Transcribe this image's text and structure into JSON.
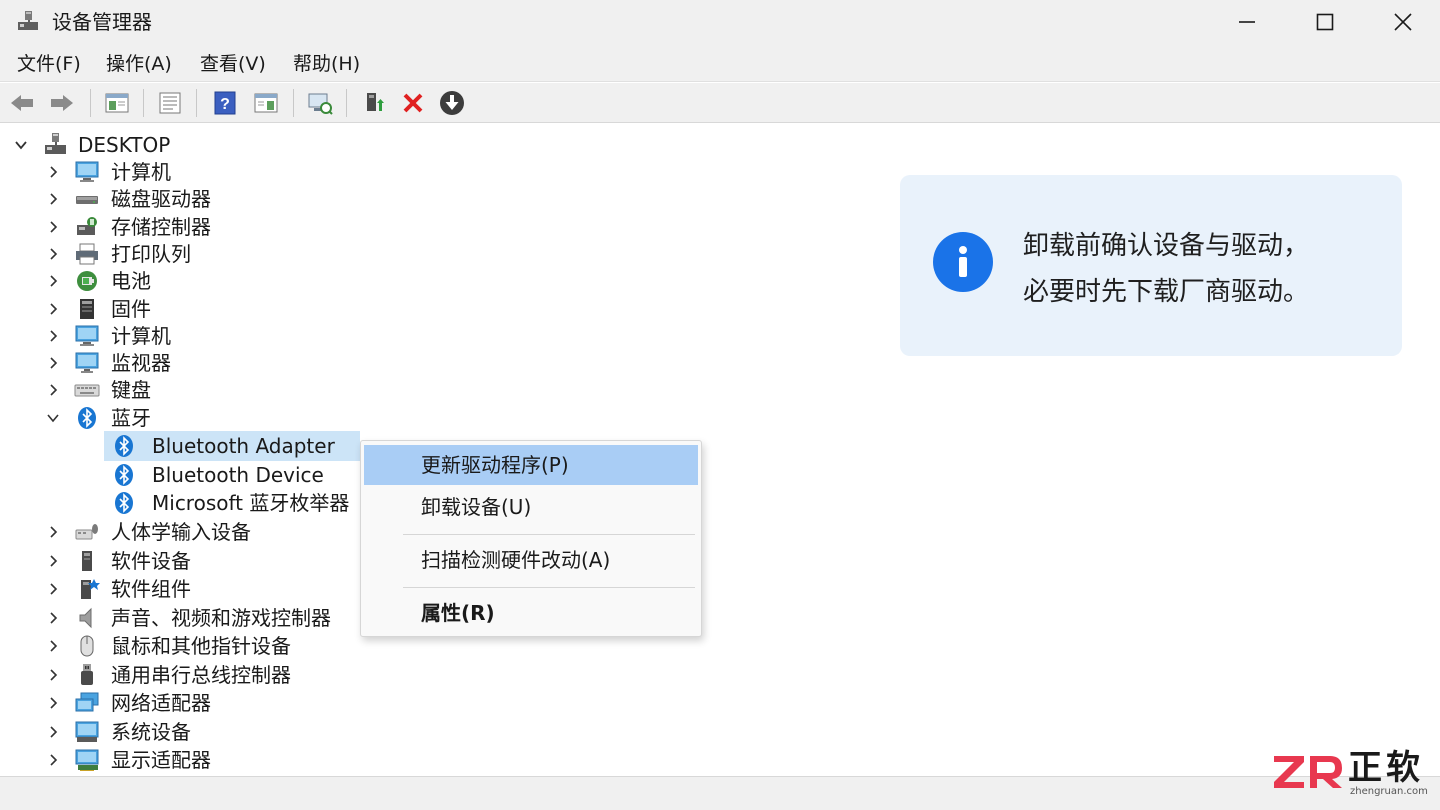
{
  "window": {
    "title": "设备管理器",
    "title_icon": "device-manager-icon",
    "controls": [
      "minimize-icon",
      "maximize-icon",
      "close-icon"
    ]
  },
  "menubar": {
    "items": [
      {
        "label": "文件(F)"
      },
      {
        "label": "操作(A)"
      },
      {
        "label": "查看(V)"
      },
      {
        "label": "帮助(H)"
      }
    ]
  },
  "toolbar": {
    "buttons": [
      "back-icon",
      "forward-icon",
      "show-hide-tree-icon",
      "properties-icon",
      "help-icon",
      "action-pane-icon",
      "scan-hardware-icon",
      "update-driver-icon",
      "uninstall-icon",
      "download-icon"
    ]
  },
  "tree": {
    "root": "DESKTOP",
    "categories": [
      {
        "label": "计算机",
        "icon": "computer-icon"
      },
      {
        "label": "磁盘驱动器",
        "icon": "disk-drive-icon"
      },
      {
        "label": "存储控制器",
        "icon": "storage-controller-icon"
      },
      {
        "label": "打印队列",
        "icon": "printer-icon"
      },
      {
        "label": "电池",
        "icon": "battery-icon"
      },
      {
        "label": "固件",
        "icon": "firmware-icon"
      },
      {
        "label": "计算机",
        "icon": "computer-icon"
      },
      {
        "label": "监视器",
        "icon": "monitor-icon"
      },
      {
        "label": "键盘",
        "icon": "keyboard-icon"
      },
      {
        "label": "蓝牙",
        "icon": "bluetooth-icon",
        "expanded": true
      }
    ],
    "bluetooth_children": [
      {
        "label": "Bluetooth Adapter",
        "selected": true
      },
      {
        "label": "Bluetooth Device"
      },
      {
        "label": "Microsoft 蓝牙枚举器"
      }
    ],
    "categories_after": [
      {
        "label": "人体学输入设备",
        "icon": "hid-icon"
      },
      {
        "label": "软件设备",
        "icon": "software-device-icon"
      },
      {
        "label": "软件组件",
        "icon": "software-component-icon"
      },
      {
        "label": "声音、视频和游戏控制器",
        "icon": "speaker-icon"
      },
      {
        "label": "鼠标和其他指针设备",
        "icon": "mouse-icon"
      },
      {
        "label": "通用串行总线控制器",
        "icon": "usb-icon"
      },
      {
        "label": "网络适配器",
        "icon": "network-adapter-icon"
      },
      {
        "label": "系统设备",
        "icon": "system-device-icon"
      },
      {
        "label": "显示适配器",
        "icon": "display-adapter-icon"
      }
    ]
  },
  "context_menu": {
    "items": [
      {
        "label": "更新驱动程序(P)",
        "highlighted": true
      },
      {
        "label": "卸载设备(U)"
      },
      {
        "label": "扫描检测硬件改动(A)"
      },
      {
        "label": "属性(R)",
        "bold": true
      }
    ]
  },
  "info_card": {
    "icon": "info-icon",
    "line1": "卸载前确认设备与驱动，",
    "line2": "必要时先下载厂商驱动。"
  },
  "watermark": {
    "logo": "ZR",
    "text": "正软",
    "url": "zhengruan.com"
  },
  "colors": {
    "accent": "#1a73e8",
    "selection": "#cce4f7",
    "menu_highlight": "#a9cdf5",
    "info_bg": "#e9f2fb",
    "bluetooth": "#1976d2",
    "watermark_red": "#e8384f"
  }
}
